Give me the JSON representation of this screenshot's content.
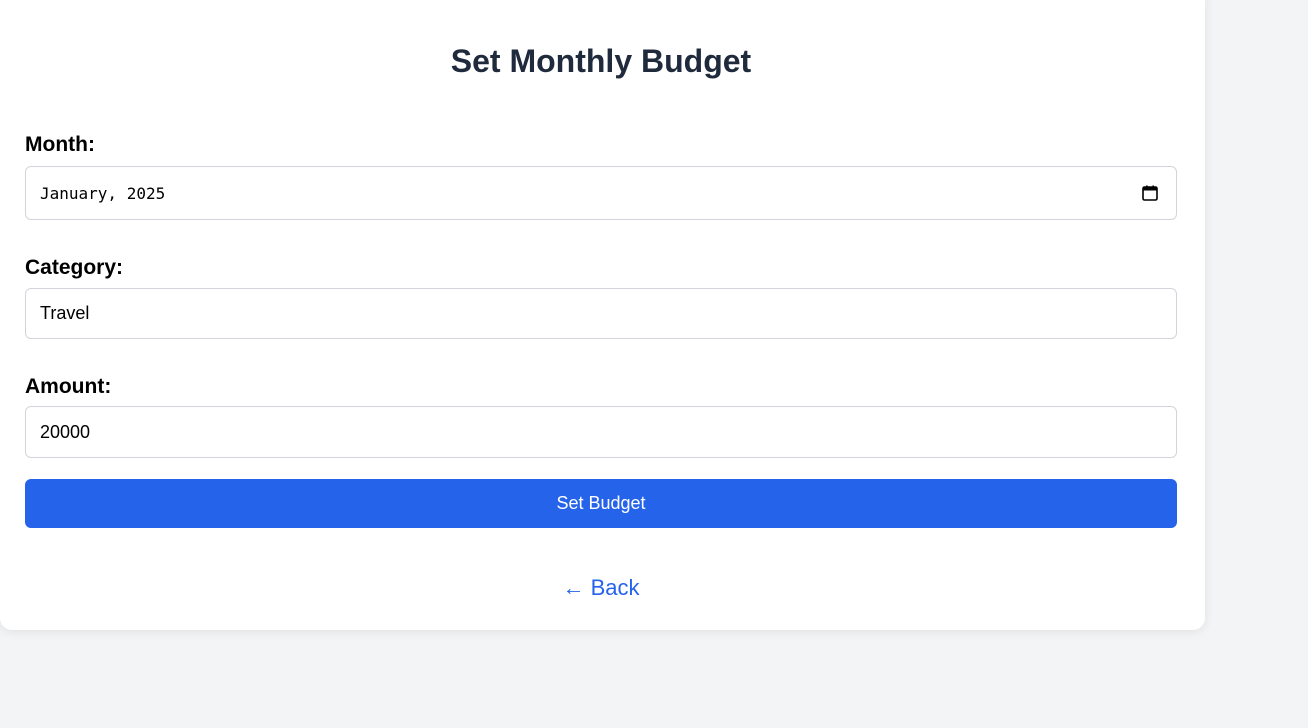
{
  "form": {
    "title": "Set Monthly Budget",
    "month": {
      "label": "Month:",
      "value": "January, 2025",
      "icon": "calendar-icon"
    },
    "category": {
      "label": "Category:",
      "value": "Travel"
    },
    "amount": {
      "label": "Amount:",
      "value": "20000"
    },
    "submit_label": "Set Budget",
    "back_label": "← Back"
  },
  "colors": {
    "background": "#f3f4f6",
    "card": "#ffffff",
    "title": "#1f2a3c",
    "accent": "#2563eb",
    "border": "#d1d5db"
  }
}
